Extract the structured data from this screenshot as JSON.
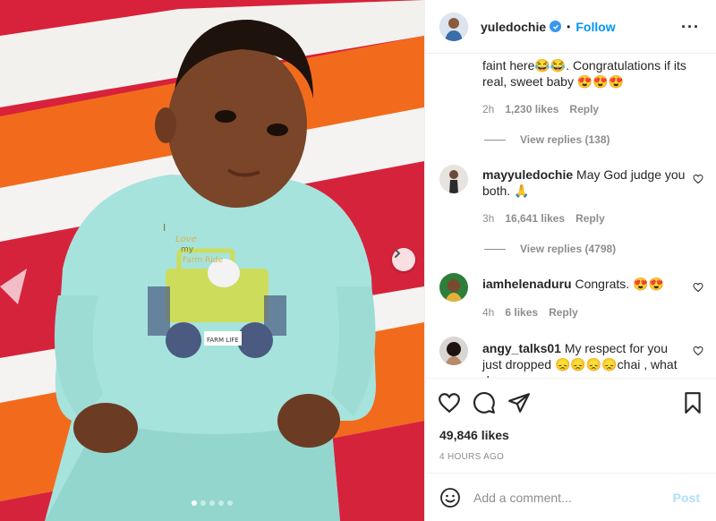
{
  "header": {
    "username": "yuledochie",
    "bullet": "•",
    "follow_label": "Follow",
    "more_label": "···"
  },
  "comments": [
    {
      "username": "",
      "text": "faint here😂😂. Congratulations if its real, sweet baby 😍😍😍",
      "age": "2h",
      "likes": "1,230 likes",
      "reply_label": "Reply",
      "view_replies": "View replies (138)"
    },
    {
      "username": "mayyuledochie",
      "text": "May God judge you both. 🙏",
      "age": "3h",
      "likes": "16,641 likes",
      "reply_label": "Reply",
      "view_replies": "View replies (4798)"
    },
    {
      "username": "iamhelenaduru",
      "text": "Congrats. 😍😍",
      "age": "4h",
      "likes": "6 likes",
      "reply_label": "Reply"
    },
    {
      "username": "angy_talks01",
      "text": "My respect for you just dropped 😞😞😞😞chai , what do"
    }
  ],
  "post": {
    "likes": "49,846 likes",
    "time": "4 HOURS AGO"
  },
  "composer": {
    "placeholder": "Add a comment...",
    "post_label": "Post"
  },
  "media": {
    "shirt_text_1": "I",
    "shirt_text_2": "Love",
    "shirt_text_3": "my",
    "shirt_text_4": "Farm Ride",
    "badge_text": "FARM LIFE",
    "dots_total": 5,
    "dots_active": 0
  },
  "colors": {
    "accent": "#0095f6",
    "post_disabled": "#b2dffc",
    "verified": "#3897f0",
    "onesie": "#a6e3dc"
  }
}
